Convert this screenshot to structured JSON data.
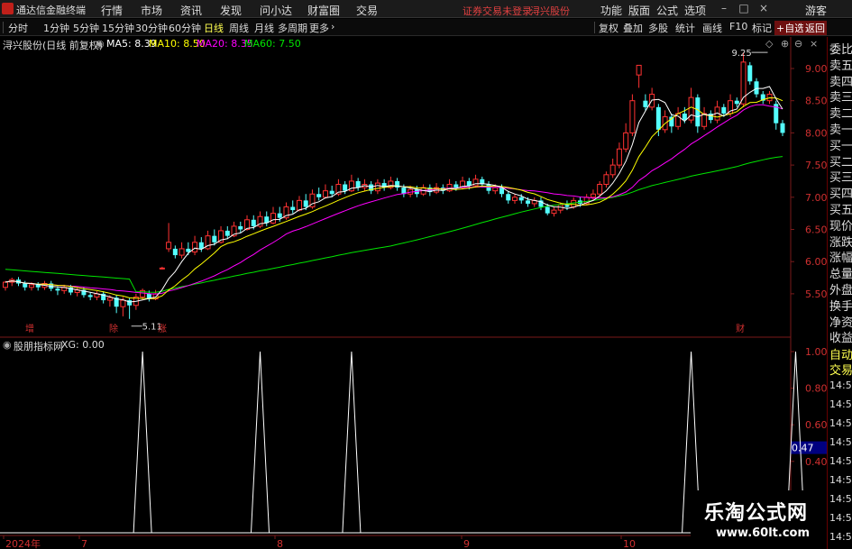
{
  "titlebar": {
    "app_name": "通达信金融终端",
    "menus": [
      "行情",
      "市场",
      "资讯",
      "发现",
      "问小达",
      "财富圈",
      "交易"
    ],
    "notice": "证券交易未登录",
    "stock": "浔兴股份",
    "right_menus": [
      "功能",
      "版面",
      "公式",
      "选项"
    ],
    "guest": "游客"
  },
  "toolbar": {
    "periods": [
      "分时",
      "1分钟",
      "5分钟",
      "15分钟",
      "30分钟",
      "60分钟",
      "日线",
      "周线",
      "月线",
      "多周期",
      "更多"
    ],
    "active_period": "日线",
    "more_arrow": "›",
    "right_tools": [
      "复权",
      "叠加",
      "多股",
      "统计",
      "画线",
      "F10",
      "标记",
      "+自选",
      "返回"
    ]
  },
  "main_header": {
    "stock_title": "浔兴股份(日线 前复权)",
    "ma5": "MA5: 8.39",
    "ma10": "MA10: 8.50",
    "ma20": "MA20: 8.35",
    "ma60": "MA60: 7.50"
  },
  "sub_header": {
    "indicator": "股朋指标网",
    "xg": "XG: 0.00"
  },
  "colors": {
    "up": "#ff3232",
    "down": "#54ffff",
    "ma5": "#ffffff",
    "ma10": "#ffff00",
    "ma20": "#ff00ff",
    "ma60": "#00e600",
    "axis_label": "#d03030",
    "grid": "#601818",
    "indicator": "#ffffff"
  },
  "price_axis": [
    "9.00",
    "8.50",
    "8.00",
    "7.50",
    "7.00",
    "6.50",
    "6.00",
    "5.50"
  ],
  "indicator_axis": [
    "1.00",
    "0.80",
    "0.60",
    "0.40",
    "0.20"
  ],
  "indicator_marker": "0.47",
  "date_axis": [
    "2024年",
    "7",
    "8",
    "9",
    "10"
  ],
  "annotations": {
    "high": "9.25",
    "low": "5.11",
    "events": [
      "增",
      "除",
      "涨",
      "财"
    ]
  },
  "side_panel": {
    "labels": [
      "委比",
      "卖五",
      "卖四",
      "卖三",
      "卖二",
      "卖一",
      "买一",
      "买二",
      "买三",
      "买四",
      "买五",
      "现价",
      "涨跌",
      "涨幅",
      "总量",
      "外盘",
      "换手",
      "净资",
      "收益"
    ],
    "lower_labels": [
      "自动",
      "交易"
    ],
    "times": [
      "14:56",
      "14:56",
      "14:56",
      "14:56",
      "14:56",
      "14:56",
      "14:56",
      "14:56",
      "14:56"
    ]
  },
  "watermark": {
    "title": "乐淘公式网",
    "url": "www.60lt.com"
  },
  "chart_data": {
    "type": "candlestick",
    "period": "daily",
    "xlabel": "",
    "ylabel": "",
    "ylim": [
      5.0,
      9.35
    ],
    "candles": [
      [
        5.6,
        5.68,
        5.7,
        5.55
      ],
      [
        5.68,
        5.72,
        5.75,
        5.62
      ],
      [
        5.72,
        5.66,
        5.76,
        5.62
      ],
      [
        5.66,
        5.6,
        5.7,
        5.55
      ],
      [
        5.6,
        5.64,
        5.68,
        5.55
      ],
      [
        5.64,
        5.6,
        5.68,
        5.55
      ],
      [
        5.6,
        5.66,
        5.7,
        5.56
      ],
      [
        5.66,
        5.58,
        5.7,
        5.54
      ],
      [
        5.58,
        5.55,
        5.62,
        5.48
      ],
      [
        5.55,
        5.6,
        5.64,
        5.5
      ],
      [
        5.6,
        5.52,
        5.64,
        5.48
      ],
      [
        5.52,
        5.56,
        5.6,
        5.46
      ],
      [
        5.56,
        5.48,
        5.6,
        5.44
      ],
      [
        5.48,
        5.45,
        5.52,
        5.4
      ],
      [
        5.45,
        5.5,
        5.54,
        5.4
      ],
      [
        5.5,
        5.4,
        5.54,
        5.35
      ],
      [
        5.4,
        5.44,
        5.48,
        5.3
      ],
      [
        5.44,
        5.3,
        5.48,
        5.2
      ],
      [
        5.3,
        5.4,
        5.45,
        5.15
      ],
      [
        5.4,
        5.32,
        5.44,
        5.11
      ],
      [
        5.32,
        5.45,
        5.5,
        5.25
      ],
      [
        5.45,
        5.55,
        5.58,
        5.4
      ],
      [
        5.5,
        5.42,
        5.55,
        5.38
      ],
      [
        5.42,
        5.5,
        5.56,
        5.4
      ],
      [
        5.9,
        5.9,
        5.92,
        5.88
      ],
      [
        6.2,
        6.3,
        6.6,
        6.15
      ],
      [
        6.2,
        6.1,
        6.25,
        6.05
      ],
      [
        6.1,
        6.2,
        6.3,
        6.05
      ],
      [
        6.2,
        6.15,
        6.3,
        6.1
      ],
      [
        6.15,
        6.3,
        6.4,
        6.1
      ],
      [
        6.3,
        6.2,
        6.38,
        6.15
      ],
      [
        6.2,
        6.4,
        6.48,
        6.18
      ],
      [
        6.4,
        6.3,
        6.5,
        6.25
      ],
      [
        6.3,
        6.48,
        6.55,
        6.28
      ],
      [
        6.48,
        6.4,
        6.55,
        6.35
      ],
      [
        6.4,
        6.55,
        6.62,
        6.38
      ],
      [
        6.55,
        6.5,
        6.62,
        6.45
      ],
      [
        6.5,
        6.65,
        6.72,
        6.48
      ],
      [
        6.65,
        6.55,
        6.72,
        6.5
      ],
      [
        6.55,
        6.7,
        6.78,
        6.52
      ],
      [
        6.7,
        6.6,
        6.78,
        6.55
      ],
      [
        6.6,
        6.75,
        6.85,
        6.58
      ],
      [
        6.75,
        6.68,
        6.85,
        6.62
      ],
      [
        6.68,
        6.85,
        6.92,
        6.65
      ],
      [
        6.85,
        6.8,
        6.95,
        6.75
      ],
      [
        6.8,
        6.95,
        7.02,
        6.78
      ],
      [
        6.95,
        6.85,
        7.05,
        6.8
      ],
      [
        6.85,
        7.05,
        7.12,
        6.82
      ],
      [
        7.05,
        7.0,
        7.15,
        6.95
      ],
      [
        7.0,
        7.1,
        7.2,
        6.98
      ],
      [
        7.1,
        7.05,
        7.18,
        7.0
      ],
      [
        7.05,
        7.2,
        7.28,
        7.02
      ],
      [
        7.2,
        7.1,
        7.25,
        7.05
      ],
      [
        7.1,
        7.25,
        7.35,
        7.08
      ],
      [
        7.25,
        7.15,
        7.3,
        7.1
      ],
      [
        7.15,
        7.2,
        7.28,
        7.1
      ],
      [
        7.2,
        7.1,
        7.25,
        7.05
      ],
      [
        7.1,
        7.22,
        7.28,
        7.05
      ],
      [
        7.22,
        7.15,
        7.28,
        7.1
      ],
      [
        7.15,
        7.25,
        7.32,
        7.12
      ],
      [
        7.25,
        7.15,
        7.3,
        7.1
      ],
      [
        7.15,
        7.05,
        7.2,
        7.0
      ],
      [
        7.05,
        7.12,
        7.18,
        7.0
      ],
      [
        7.12,
        7.05,
        7.18,
        7.0
      ],
      [
        7.05,
        7.15,
        7.2,
        7.02
      ],
      [
        7.15,
        7.08,
        7.2,
        7.02
      ],
      [
        7.08,
        7.15,
        7.22,
        7.05
      ],
      [
        7.15,
        7.1,
        7.2,
        7.05
      ],
      [
        7.1,
        7.2,
        7.28,
        7.08
      ],
      [
        7.2,
        7.15,
        7.25,
        7.1
      ],
      [
        7.15,
        7.25,
        7.32,
        7.12
      ],
      [
        7.25,
        7.18,
        7.3,
        7.12
      ],
      [
        7.18,
        7.28,
        7.35,
        7.15
      ],
      [
        7.28,
        7.2,
        7.32,
        7.15
      ],
      [
        7.2,
        7.1,
        7.25,
        7.05
      ],
      [
        7.1,
        7.15,
        7.2,
        7.05
      ],
      [
        7.15,
        7.05,
        7.2,
        7.0
      ],
      [
        7.05,
        6.95,
        7.1,
        6.9
      ],
      [
        6.95,
        7.0,
        7.05,
        6.9
      ],
      [
        7.0,
        6.95,
        7.05,
        6.9
      ],
      [
        6.95,
        6.9,
        7.0,
        6.85
      ],
      [
        6.9,
        6.95,
        7.0,
        6.85
      ],
      [
        6.95,
        6.85,
        7.0,
        6.8
      ],
      [
        6.85,
        6.75,
        6.9,
        6.72
      ],
      [
        6.75,
        6.8,
        6.85,
        6.7
      ],
      [
        6.8,
        6.88,
        6.92,
        6.75
      ],
      [
        6.88,
        6.85,
        6.95,
        6.8
      ],
      [
        6.85,
        6.95,
        7.0,
        6.82
      ],
      [
        6.95,
        6.9,
        7.0,
        6.85
      ],
      [
        6.9,
        7.0,
        7.05,
        6.88
      ],
      [
        7.0,
        7.05,
        7.12,
        6.95
      ],
      [
        7.05,
        7.2,
        7.25,
        7.0
      ],
      [
        7.2,
        7.35,
        7.4,
        7.15
      ],
      [
        7.35,
        7.5,
        7.6,
        7.3
      ],
      [
        7.5,
        7.75,
        7.85,
        7.45
      ],
      [
        7.75,
        8.0,
        8.15,
        7.7
      ],
      [
        8.0,
        8.5,
        8.6,
        7.95
      ],
      [
        8.9,
        9.05,
        9.05,
        8.7
      ],
      [
        8.5,
        8.4,
        8.6,
        8.35
      ],
      [
        8.4,
        8.6,
        8.7,
        8.35
      ],
      [
        8.4,
        8.05,
        8.45,
        7.95
      ],
      [
        8.05,
        8.25,
        8.35,
        8.0
      ],
      [
        8.25,
        8.1,
        8.3,
        8.0
      ],
      [
        8.1,
        8.3,
        8.4,
        8.05
      ],
      [
        8.3,
        8.2,
        8.4,
        8.15
      ],
      [
        8.2,
        8.55,
        8.7,
        8.15
      ],
      [
        8.55,
        8.1,
        8.6,
        8.0
      ],
      [
        8.1,
        8.3,
        8.4,
        8.05
      ],
      [
        8.3,
        8.2,
        8.35,
        8.15
      ],
      [
        8.2,
        8.4,
        8.5,
        8.15
      ],
      [
        8.4,
        8.3,
        8.45,
        8.25
      ],
      [
        8.3,
        8.5,
        8.6,
        8.25
      ],
      [
        8.5,
        8.45,
        8.55,
        8.4
      ],
      [
        8.45,
        9.1,
        9.25,
        8.4
      ],
      [
        9.05,
        8.8,
        9.1,
        8.75
      ],
      [
        8.8,
        8.6,
        8.85,
        8.55
      ],
      [
        8.6,
        8.5,
        8.65,
        8.45
      ],
      [
        8.5,
        8.6,
        8.65,
        8.45
      ],
      [
        8.45,
        8.15,
        8.5,
        8.05
      ],
      [
        8.15,
        8.0,
        8.2,
        7.95
      ]
    ],
    "ma5": [],
    "ma10": [],
    "ma20": [],
    "ma60": [],
    "indicator": {
      "name": "XG",
      "range": [
        0,
        1.0
      ],
      "signal_indices": [
        21,
        39,
        53,
        105,
        121
      ]
    }
  }
}
